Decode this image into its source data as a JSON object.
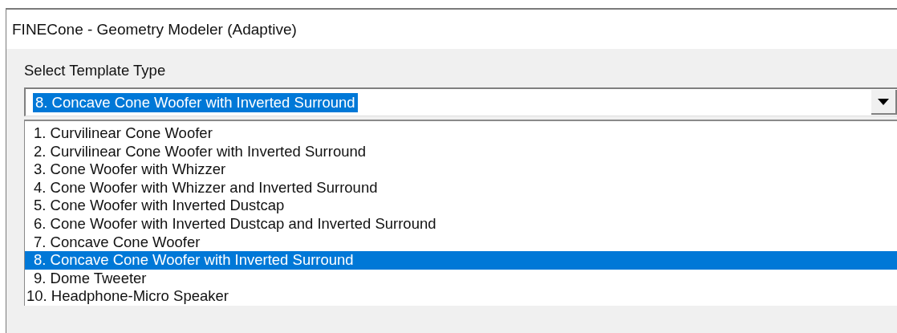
{
  "window": {
    "title": "FINECone - Geometry Modeler (Adaptive)"
  },
  "template_label": "Select Template Type",
  "combo": {
    "value": "8. Concave Cone Woofer with Inverted Surround",
    "expanded": true
  },
  "items": [
    {
      "label": "1. Curvilinear Cone Woofer",
      "selected": false
    },
    {
      "label": "2. Curvilinear Cone Woofer with Inverted Surround",
      "selected": false
    },
    {
      "label": "3. Cone Woofer with Whizzer",
      "selected": false
    },
    {
      "label": "4. Cone Woofer with Whizzer and Inverted Surround",
      "selected": false
    },
    {
      "label": "5. Cone Woofer with Inverted Dustcap",
      "selected": false
    },
    {
      "label": "6. Cone Woofer with Inverted Dustcap and Inverted Surround",
      "selected": false
    },
    {
      "label": "7. Concave Cone Woofer",
      "selected": false
    },
    {
      "label": "8. Concave Cone Woofer with Inverted Surround",
      "selected": true
    },
    {
      "label": "9. Dome Tweeter",
      "selected": false
    },
    {
      "label": "10. Headphone-Micro Speaker",
      "selected": false
    }
  ]
}
